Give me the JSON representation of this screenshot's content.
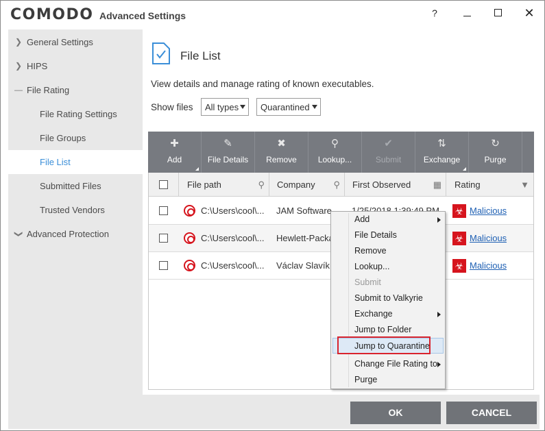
{
  "window": {
    "brand": "COMODO",
    "title": "Advanced Settings",
    "help": "?"
  },
  "sidebar": {
    "items": [
      {
        "label": "General Settings",
        "chevron": "expand"
      },
      {
        "label": "HIPS",
        "chevron": "expand"
      },
      {
        "label": "File Rating",
        "chevron": "collapse"
      },
      {
        "label": "File Rating Settings"
      },
      {
        "label": "File Groups"
      },
      {
        "label": "File List",
        "active": true
      },
      {
        "label": "Submitted Files"
      },
      {
        "label": "Trusted Vendors"
      },
      {
        "label": "Advanced Protection",
        "chevron": "collapse-down"
      }
    ]
  },
  "main": {
    "title": "File List",
    "description": "View details and manage rating of known executables.",
    "show_files_label": "Show files",
    "filter_type": "All types",
    "filter_location": "Quarantined"
  },
  "toolbar": {
    "buttons": [
      {
        "label": "Add",
        "icon": "plus-icon"
      },
      {
        "label": "File Details",
        "icon": "pencil-icon"
      },
      {
        "label": "Remove",
        "icon": "x-icon"
      },
      {
        "label": "Lookup...",
        "icon": "search-icon"
      },
      {
        "label": "Submit",
        "icon": "check-icon",
        "disabled": true
      },
      {
        "label": "Exchange",
        "icon": "exchange-icon"
      },
      {
        "label": "Purge",
        "icon": "refresh-icon"
      }
    ]
  },
  "table": {
    "columns": [
      "File path",
      "Company",
      "First Observed",
      "Rating"
    ],
    "rows": [
      {
        "path": "C:\\Users\\cool\\...",
        "company": "JAM Software",
        "observed": "1/25/2018 1:39:49 PM",
        "rating": "Malicious"
      },
      {
        "path": "C:\\Users\\cool\\...",
        "company": "Hewlett-Packard",
        "observed": "",
        "rating": "Malicious"
      },
      {
        "path": "C:\\Users\\cool\\...",
        "company": "Václav Slavík",
        "observed": "",
        "rating": "Malicious"
      }
    ]
  },
  "context_menu": {
    "items": [
      {
        "label": "Add",
        "submenu": true
      },
      {
        "label": "File Details"
      },
      {
        "label": "Remove"
      },
      {
        "label": "Lookup..."
      },
      {
        "label": "Submit",
        "disabled": true
      },
      {
        "label": "Submit to Valkyrie"
      },
      {
        "label": "Exchange",
        "submenu": true
      },
      {
        "label": "Jump to Folder"
      },
      {
        "label": "Jump to Quarantine",
        "highlighted": true
      },
      {
        "label": "Change File Rating to",
        "submenu": true
      },
      {
        "label": "Purge"
      }
    ]
  },
  "footer": {
    "ok": "OK",
    "cancel": "CANCEL"
  },
  "colors": {
    "accent": "#3a8ed8",
    "toolbar": "#777a80",
    "malicious": "#d6141d",
    "highlight_box": "#d9232d"
  }
}
